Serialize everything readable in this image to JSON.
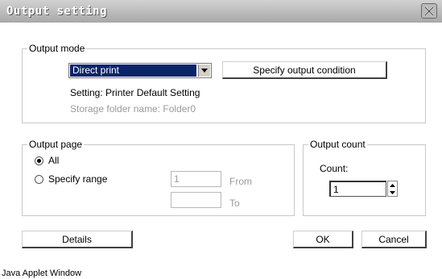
{
  "window": {
    "title": "Output setting",
    "close_icon": "close-icon"
  },
  "output_mode": {
    "legend": "Output mode",
    "select_value": "Direct print",
    "specify_button": "Specify output condition",
    "setting_text": "Setting: Printer Default Setting",
    "storage_text": "Storage folder name: Folder0"
  },
  "output_page": {
    "legend": "Output page",
    "all_label": "All",
    "all_selected": true,
    "range_label": "Specify range",
    "from_value": "1",
    "from_label": "From",
    "to_value": "",
    "to_label": "To"
  },
  "output_count": {
    "legend": "Output count",
    "count_label": "Count:",
    "count_value": "1"
  },
  "buttons": {
    "details": "Details",
    "ok": "OK",
    "cancel": "Cancel"
  },
  "footer": {
    "status": "Java Applet Window"
  }
}
